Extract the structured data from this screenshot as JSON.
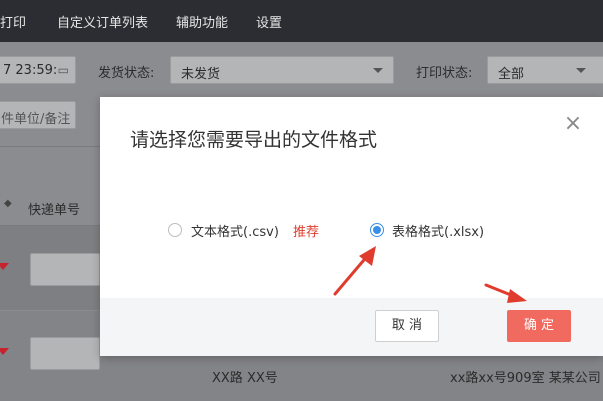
{
  "topnav": {
    "items": [
      "打印",
      "自定义订单列表",
      "辅助功能",
      "设置"
    ]
  },
  "filters": {
    "date_value": "7 23:59:",
    "ship_status_label": "发货状态:",
    "ship_status_value": "未发货",
    "print_status_label": "打印状态:",
    "print_status_value": "全部",
    "search_placeholder": "件单位/备注"
  },
  "table": {
    "tracking_header": "快递单号",
    "row2_addr_left": "XX路 XX号",
    "row2_addr_right": "xx路xx号909室  某某公司"
  },
  "modal": {
    "title": "请选择您需要导出的文件格式",
    "close_glyph": "×",
    "option_csv": "文本格式(.csv)",
    "recommend": "推荐",
    "option_xlsx": "表格格式(.xlsx)",
    "selected": "xlsx",
    "cancel": "取 消",
    "confirm": "确 定"
  },
  "colors": {
    "accent": "#3a8ee6",
    "confirm": "#f06a5f",
    "arrow": "#e03c2d"
  }
}
